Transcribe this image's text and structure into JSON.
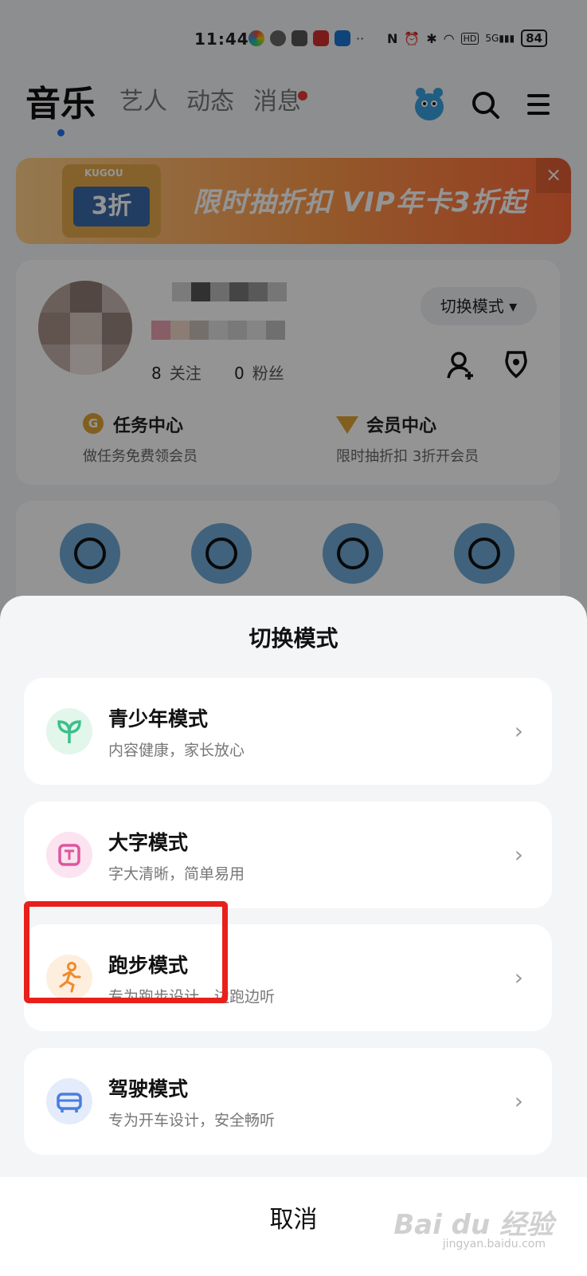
{
  "status_bar": {
    "time": "11:44",
    "network": "5G",
    "hd": "HD",
    "battery": "84"
  },
  "header": {
    "tabs": [
      {
        "label": "音乐",
        "active": true
      },
      {
        "label": "艺人",
        "active": false
      },
      {
        "label": "动态",
        "active": false
      },
      {
        "label": "消息",
        "active": false,
        "has_red_dot": true
      }
    ]
  },
  "banner": {
    "brand": "KUGOU",
    "screen_text": "3折",
    "text": "限时抽折扣 VIP年卡3折起",
    "close": "×"
  },
  "profile": {
    "mode_button": "切换模式 ▾",
    "following_count": "8",
    "following_label": "关注",
    "fans_count": "0",
    "fans_label": "粉丝"
  },
  "cells": [
    {
      "badge": "G",
      "title": "任务中心",
      "subtitle": "做任务免费领会员"
    },
    {
      "badge": "V",
      "title": "会员中心",
      "subtitle": "限时抽折扣 3折开会员"
    }
  ],
  "sheet": {
    "title": "切换模式",
    "options": [
      {
        "title": "青少年模式",
        "subtitle": "内容健康，家长放心",
        "icon": "sprout-icon",
        "color": "#3cc08a"
      },
      {
        "title": "大字模式",
        "subtitle": "字大清晰，简单易用",
        "icon": "text-t-icon",
        "color": "#e0559e"
      },
      {
        "title": "跑步模式",
        "subtitle": "专为跑步设计，边跑边听",
        "icon": "runner-icon",
        "color": "#f08a2b"
      },
      {
        "title": "驾驶模式",
        "subtitle": "专为开车设计，安全畅听",
        "icon": "car-icon",
        "color": "#4a7de0"
      }
    ],
    "cancel": "取消"
  },
  "watermark": {
    "brand": "Bai du 经验",
    "url": "jingyan.baidu.com"
  }
}
